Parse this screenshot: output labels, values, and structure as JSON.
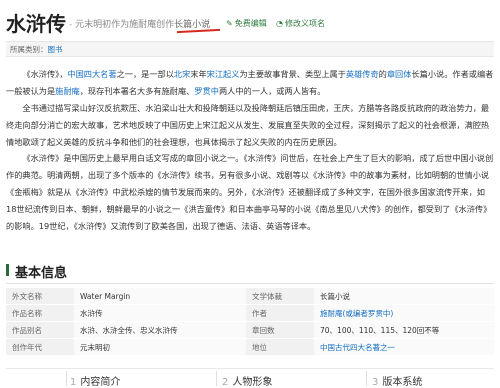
{
  "header": {
    "title": "水浒传",
    "subtitle_sep": "-",
    "subtitle_main": "元末明初作为施耐庵创作",
    "subtitle_highlight": "长篇小说",
    "edit_label": "免费编辑",
    "edit_icon": "pencil-icon",
    "history_label": "修改义项名",
    "history_icon": "history-icon"
  },
  "category_bar": {
    "prefix": "所属类别：",
    "value": "图书"
  },
  "paragraphs": [
    {
      "segments": [
        {
          "t": "《水浒传》，"
        },
        {
          "t": "中国四大名著",
          "link": true
        },
        {
          "t": "之一，是一部以"
        },
        {
          "t": "北宋",
          "link": true
        },
        {
          "t": "末年"
        },
        {
          "t": "宋江起义",
          "link": true
        },
        {
          "t": "为主要故事背景、类型上属于"
        },
        {
          "t": "英雄传奇",
          "link": true
        },
        {
          "t": "的"
        },
        {
          "t": "章回体",
          "link": true
        },
        {
          "t": "长篇小说。作者或编者一般被认为是"
        },
        {
          "t": "施耐庵",
          "link": true
        },
        {
          "t": "，现存刊本署名大多有施耐庵、"
        },
        {
          "t": "罗贯中",
          "link": true
        },
        {
          "t": "两人中的一人，或两人皆有。"
        }
      ]
    },
    {
      "segments": [
        {
          "t": "全书通过描写梁山好汉反抗欺压、水泊梁山壮大和投降朝廷以及投降朝廷后镇压田虎，王庆，方腊等各路反抗政府的政治势力，最终走向部分消亡的宏大故事，艺术地反映了中国历史上宋江起义从发生、发展直至失败的全过程，深刻揭示了起义的社会根源，满腔热情地歌颂了起义英雄的反抗斗争和他们的社会理想，也具体揭示了起义失败的内在历史原因。"
        }
      ]
    },
    {
      "segments": [
        {
          "t": "《水浒传》是中国历史上最早用白话文写成的章回小说之一。《水浒传》问世后，在社会上产生了巨大的影响，成了后世中国小说创作的典范。明清两朝，出现了多个版本的《水浒传》续书，另有很多小说、戏剧等以《水浒传》中的故事为素材，比如明朝的世情小说《金瓶梅》就是从《水浒传》中武松杀嫂的情节发展而来的。另外，《水浒传》还被翻译成了多种文字，在国外很多国家流传开来，如18世纪流传到日本、朝鲜，朝鲜最早的小说之一《洪吉童传》和日本曲亭马琴的小说《南总里见八犬传》的创作，都受到了《水浒传》的影响。19世纪，《水浒传》又流传到了欧美各国，出现了德语、法语、英语等译本。"
        }
      ]
    }
  ],
  "basic_info": {
    "title": "基本信息",
    "rows": [
      {
        "k1": "外文名称",
        "v1": "Water Margin",
        "v1_link": false,
        "k2": "文学体裁",
        "v2": "长篇小说",
        "v2_link": false
      },
      {
        "k1": "作品名称",
        "v1": "水浒传",
        "v1_link": false,
        "k2": "作者",
        "v2": "施耐庵(或编者罗贯中)",
        "v2_link": true
      },
      {
        "k1": "作品别名",
        "v1": "水浒、水浒全传、忠义水浒传",
        "v1_link": false,
        "k2": "章回数",
        "v2": "70、100、110、115、120回不等",
        "v2_link": false
      },
      {
        "k1": "创作年代",
        "v1": "元末明初",
        "v1_link": false,
        "k2": "地位",
        "v2": "中国古代四大名著之一",
        "v2_link": true
      }
    ]
  },
  "toc": [
    {
      "num": "1",
      "label": "内容简介"
    },
    {
      "num": "2",
      "label": "人物形象"
    },
    {
      "num": "3",
      "label": "版本系统"
    }
  ]
}
